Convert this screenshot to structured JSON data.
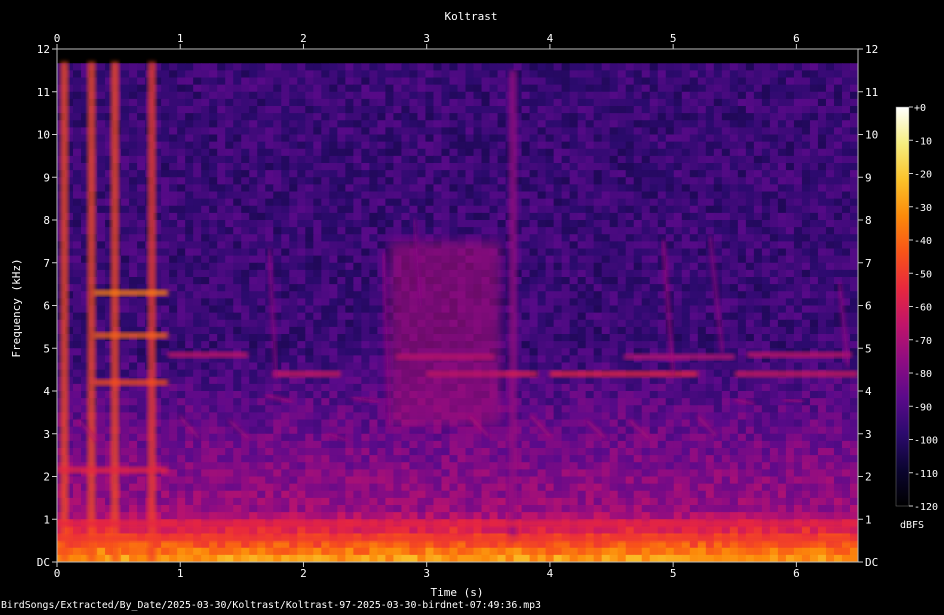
{
  "chart_data": {
    "type": "heatmap",
    "title": "Koltrast",
    "xlabel": "Time (s)",
    "ylabel": "Frequency (kHz)",
    "xlim": [
      0,
      6.5
    ],
    "ylim": [
      0,
      12
    ],
    "x_ticks": [
      {
        "value": 0,
        "label": "0"
      },
      {
        "value": 1,
        "label": "1"
      },
      {
        "value": 2,
        "label": "2"
      },
      {
        "value": 3,
        "label": "3"
      },
      {
        "value": 4,
        "label": "4"
      },
      {
        "value": 5,
        "label": "5"
      },
      {
        "value": 6,
        "label": "6"
      }
    ],
    "y_ticks": [
      {
        "value": 0,
        "label": "DC"
      },
      {
        "value": 1,
        "label": "1"
      },
      {
        "value": 2,
        "label": "2"
      },
      {
        "value": 3,
        "label": "3"
      },
      {
        "value": 4,
        "label": "4"
      },
      {
        "value": 5,
        "label": "5"
      },
      {
        "value": 6,
        "label": "6"
      },
      {
        "value": 7,
        "label": "7"
      },
      {
        "value": 8,
        "label": "8"
      },
      {
        "value": 9,
        "label": "9"
      },
      {
        "value": 10,
        "label": "10"
      },
      {
        "value": 11,
        "label": "11"
      },
      {
        "value": 12,
        "label": "12"
      }
    ],
    "colorbar": {
      "unit": "dBFS",
      "range": [
        -120,
        0
      ],
      "ticks": [
        {
          "value": 0,
          "label": "+0"
        },
        {
          "value": -10,
          "label": "-10"
        },
        {
          "value": -20,
          "label": "-20"
        },
        {
          "value": -30,
          "label": "-30"
        },
        {
          "value": -40,
          "label": "-40"
        },
        {
          "value": -50,
          "label": "-50"
        },
        {
          "value": -60,
          "label": "-60"
        },
        {
          "value": -70,
          "label": "-70"
        },
        {
          "value": -80,
          "label": "-80"
        },
        {
          "value": -90,
          "label": "-90"
        },
        {
          "value": -100,
          "label": "-100"
        },
        {
          "value": -110,
          "label": "-110"
        },
        {
          "value": -120,
          "label": "-120"
        }
      ],
      "colors": [
        "#000000",
        "#0b0530",
        "#2c0a6e",
        "#5b0a8a",
        "#8e0c82",
        "#c0146a",
        "#e8283e",
        "#f85418",
        "#fc8a0a",
        "#fbc32a",
        "#f6ee80",
        "#ffffff"
      ]
    },
    "background_level_dbfs": -95,
    "events": [
      {
        "kind": "broadband",
        "t": 0.06,
        "f_min": 0,
        "f_max": 11.7,
        "level_dbfs": -45
      },
      {
        "kind": "broadband",
        "t": 0.28,
        "f_min": 0,
        "f_max": 11.7,
        "level_dbfs": -45
      },
      {
        "kind": "broadband",
        "t": 0.47,
        "f_min": 0,
        "f_max": 11.7,
        "level_dbfs": -45
      },
      {
        "kind": "broadband",
        "t": 0.77,
        "f_min": 0,
        "f_max": 11.7,
        "level_dbfs": -48
      },
      {
        "kind": "broadband",
        "t": 3.7,
        "f_min": 0.5,
        "f_max": 11.5,
        "level_dbfs": -75
      },
      {
        "kind": "tone",
        "t_start": 0.3,
        "t_end": 0.9,
        "f": 6.3,
        "level_dbfs": -35
      },
      {
        "kind": "tone",
        "t_start": 0.3,
        "t_end": 0.9,
        "f": 5.3,
        "level_dbfs": -40
      },
      {
        "kind": "tone",
        "t_start": 0.3,
        "t_end": 0.9,
        "f": 4.2,
        "level_dbfs": -45
      },
      {
        "kind": "tone",
        "t_start": 0.0,
        "t_end": 0.9,
        "f": 2.15,
        "level_dbfs": -55
      },
      {
        "kind": "tone",
        "t_start": 0.9,
        "t_end": 1.55,
        "f": 4.85,
        "level_dbfs": -65
      },
      {
        "kind": "tone",
        "t_start": 1.75,
        "t_end": 2.3,
        "f": 4.4,
        "level_dbfs": -62
      },
      {
        "kind": "tone",
        "t_start": 2.75,
        "t_end": 3.55,
        "f": 4.8,
        "level_dbfs": -62
      },
      {
        "kind": "tone",
        "t_start": 3.0,
        "t_end": 3.9,
        "f": 4.4,
        "level_dbfs": -58
      },
      {
        "kind": "tone",
        "t_start": 4.0,
        "t_end": 5.2,
        "f": 4.4,
        "level_dbfs": -55
      },
      {
        "kind": "tone",
        "t_start": 5.5,
        "t_end": 6.5,
        "f": 4.4,
        "level_dbfs": -62
      },
      {
        "kind": "tone",
        "t_start": 4.6,
        "t_end": 5.5,
        "f": 4.8,
        "level_dbfs": -68
      },
      {
        "kind": "tone",
        "t_start": 5.6,
        "t_end": 6.45,
        "f": 4.85,
        "level_dbfs": -65
      },
      {
        "kind": "tone",
        "t_start": 0.0,
        "t_end": 6.5,
        "f": 0.55,
        "level_dbfs": -50
      },
      {
        "kind": "tone",
        "t_start": 0.0,
        "t_end": 6.5,
        "f": 0.9,
        "level_dbfs": -55
      },
      {
        "kind": "blob",
        "t_start": 2.7,
        "t_end": 3.6,
        "f_min": 3.2,
        "f_max": 7.5,
        "level_dbfs": -70
      },
      {
        "kind": "sweep",
        "t0": 0.18,
        "f0": 3.3,
        "t1": 0.32,
        "f1": 2.85,
        "level_dbfs": -70
      },
      {
        "kind": "sweep",
        "t0": 1.0,
        "f0": 3.4,
        "t1": 1.15,
        "f1": 2.9,
        "level_dbfs": -72
      },
      {
        "kind": "sweep",
        "t0": 1.4,
        "f0": 3.3,
        "t1": 1.55,
        "f1": 2.9,
        "level_dbfs": -72
      },
      {
        "kind": "sweep",
        "t0": 2.2,
        "f0": 3.0,
        "t1": 2.35,
        "f1": 2.85,
        "level_dbfs": -72
      },
      {
        "kind": "sweep",
        "t0": 3.35,
        "f0": 3.4,
        "t1": 3.5,
        "f1": 2.95,
        "level_dbfs": -70
      },
      {
        "kind": "sweep",
        "t0": 3.85,
        "f0": 3.4,
        "t1": 4.0,
        "f1": 2.95,
        "level_dbfs": -70
      },
      {
        "kind": "sweep",
        "t0": 4.3,
        "f0": 3.3,
        "t1": 4.45,
        "f1": 2.9,
        "level_dbfs": -70
      },
      {
        "kind": "sweep",
        "t0": 4.65,
        "f0": 3.3,
        "t1": 4.8,
        "f1": 2.9,
        "level_dbfs": -70
      },
      {
        "kind": "sweep",
        "t0": 5.2,
        "f0": 3.4,
        "t1": 5.35,
        "f1": 2.95,
        "level_dbfs": -72
      },
      {
        "kind": "sweep",
        "t0": 1.7,
        "f0": 3.9,
        "t1": 1.9,
        "f1": 3.75,
        "level_dbfs": -70
      },
      {
        "kind": "sweep",
        "t0": 2.4,
        "f0": 3.85,
        "t1": 2.6,
        "f1": 3.75,
        "level_dbfs": -70
      },
      {
        "kind": "sweep",
        "t0": 5.5,
        "f0": 3.8,
        "t1": 5.65,
        "f1": 3.7,
        "level_dbfs": -70
      },
      {
        "kind": "sweep",
        "t0": 5.9,
        "f0": 3.8,
        "t1": 6.05,
        "f1": 3.75,
        "level_dbfs": -70
      },
      {
        "kind": "sweep",
        "t0": 2.65,
        "f0": 7.2,
        "t1": 2.7,
        "f1": 3.2,
        "level_dbfs": -75
      },
      {
        "kind": "sweep",
        "t0": 1.72,
        "f0": 7.3,
        "t1": 1.78,
        "f1": 4.3,
        "level_dbfs": -75
      },
      {
        "kind": "sweep",
        "t0": 4.92,
        "f0": 7.5,
        "t1": 5.0,
        "f1": 4.4,
        "level_dbfs": -72
      },
      {
        "kind": "sweep",
        "t0": 5.3,
        "f0": 7.6,
        "t1": 5.4,
        "f1": 4.9,
        "level_dbfs": -75
      },
      {
        "kind": "sweep",
        "t0": 2.9,
        "f0": 8.0,
        "t1": 2.95,
        "f1": 6.0,
        "level_dbfs": -78
      },
      {
        "kind": "sweep",
        "t0": 6.35,
        "f0": 6.5,
        "t1": 6.42,
        "f1": 4.6,
        "level_dbfs": -75
      }
    ]
  },
  "footer": {
    "file_path": "BirdSongs/Extracted/By_Date/2025-03-30/Koltrast/Koltrast-97-2025-03-30-birdnet-07:49:36.mp3"
  }
}
